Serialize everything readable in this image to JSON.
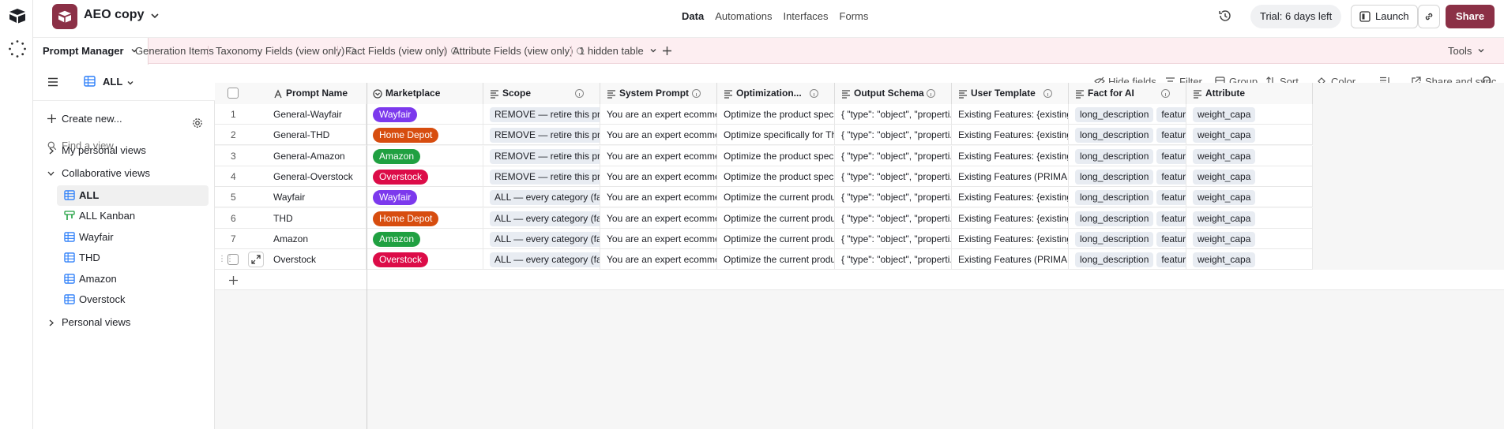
{
  "base": {
    "name": "AEO copy",
    "brand_color": "#8b3046"
  },
  "nav": [
    "Data",
    "Automations",
    "Interfaces",
    "Forms"
  ],
  "nav_active": "Data",
  "header": {
    "trial": "Trial: 6 days left",
    "launch": "Launch",
    "share": "Share"
  },
  "tables": [
    {
      "label": "Prompt Manager",
      "active": true,
      "has_chevron": true
    },
    {
      "label": "Generation Items",
      "info": false
    },
    {
      "label": "Taxonomy Fields (view only)",
      "info": true
    },
    {
      "label": "Fact Fields (view only)",
      "info": true
    },
    {
      "label": "Attribute Fields (view only)",
      "info": true
    },
    {
      "label": "1 hidden table",
      "has_chevron": true
    }
  ],
  "tools_label": "Tools",
  "view": {
    "name": "ALL"
  },
  "toolbar": {
    "hide_fields": "Hide fields",
    "filter": "Filter",
    "group": "Group",
    "sort": "Sort",
    "color": "Color",
    "share_sync": "Share and sync"
  },
  "sidebar": {
    "create": "Create new...",
    "find_placeholder": "Find a view",
    "personal_section": "My personal views",
    "collab_section": "Collaborative views",
    "views": [
      {
        "label": "ALL",
        "icon": "grid-icon",
        "active": true
      },
      {
        "label": "ALL Kanban",
        "icon": "kanban-icon"
      },
      {
        "label": "Wayfair",
        "icon": "grid-icon"
      },
      {
        "label": "THD",
        "icon": "grid-icon"
      },
      {
        "label": "Amazon",
        "icon": "grid-icon"
      },
      {
        "label": "Overstock",
        "icon": "grid-icon"
      }
    ],
    "personal_views": "Personal views"
  },
  "columns": [
    {
      "label": "Prompt Name",
      "icon": "text-icon"
    },
    {
      "label": "Marketplace",
      "icon": "select-icon"
    },
    {
      "label": "Scope",
      "icon": "longtext-icon"
    },
    {
      "label": "System Prompt",
      "icon": "longtext-icon"
    },
    {
      "label": "Optimization...",
      "icon": "longtext-icon"
    },
    {
      "label": "Output Schema",
      "icon": "longtext-icon"
    },
    {
      "label": "User Template",
      "icon": "longtext-icon"
    },
    {
      "label": "Fact for AI",
      "icon": "longtext-icon"
    },
    {
      "label": "Attribute",
      "icon": "longtext-icon"
    }
  ],
  "marketplace_colors": {
    "Wayfair": "#7c39ed",
    "Home Depot": "#d74d0f",
    "Amazon": "#20a041",
    "Overstock": "#dc0c48"
  },
  "rows": [
    {
      "n": "1",
      "name": "General-Wayfair",
      "market": "Wayfair",
      "scope": "REMOVE — retire this prompt",
      "system": "You are an expert ecommer...",
      "opt": "Optimize the product speci...",
      "schema": "{ \"type\": \"object\", \"properti...",
      "tmpl": "Existing Features: {existing_...",
      "fact1": "long_description",
      "fact2": "features",
      "attr": "weight_capa"
    },
    {
      "n": "2",
      "name": "General-THD",
      "market": "Home Depot",
      "scope": "REMOVE — retire this prompt",
      "system": "You are an expert ecommer...",
      "opt": "Optimize specifically for Th...",
      "schema": "{ \"type\": \"object\", \"properti...",
      "tmpl": "Existing Features: {existing_...",
      "fact1": "long_description",
      "fact2": "features",
      "attr": "weight_capa"
    },
    {
      "n": "3",
      "name": "General-Amazon",
      "market": "Amazon",
      "scope": "REMOVE — retire this prompt",
      "system": "You are an expert ecommer...",
      "opt": "Optimize the product speci...",
      "schema": "{ \"type\": \"object\", \"properti...",
      "tmpl": "Existing Features: {existing_...",
      "fact1": "long_description",
      "fact2": "features",
      "attr": "weight_capa"
    },
    {
      "n": "4",
      "name": "General-Overstock",
      "market": "Overstock",
      "scope": "REMOVE — retire this prompt",
      "system": "You are an expert ecommer...",
      "opt": "Optimize the product speci...",
      "schema": "{ \"type\": \"object\", \"properti...",
      "tmpl": "Existing Features (PRIMARY...",
      "fact1": "long_description",
      "fact2": "features",
      "attr": "weight_capa"
    },
    {
      "n": "5",
      "name": "Wayfair",
      "market": "Wayfair",
      "scope": "ALL — every category (fallback",
      "system": "You are an expert ecommer...",
      "opt": "Optimize the current produ...",
      "schema": "{ \"type\": \"object\", \"properti...",
      "tmpl": "Existing Features: {existing_...",
      "fact1": "long_description",
      "fact2": "features",
      "attr": "weight_capa"
    },
    {
      "n": "6",
      "name": "THD",
      "market": "Home Depot",
      "scope": "ALL — every category (fallback",
      "system": "You are an expert ecommer...",
      "opt": "Optimize the current produ...",
      "schema": "{ \"type\": \"object\", \"properti...",
      "tmpl": "Existing Features: {existing_...",
      "fact1": "long_description",
      "fact2": "features",
      "attr": "weight_capa"
    },
    {
      "n": "7",
      "name": "Amazon",
      "market": "Amazon",
      "scope": "ALL — every category (fallback",
      "system": "You are an expert ecommer...",
      "opt": "Optimize the current produ...",
      "schema": "{ \"type\": \"object\", \"properti...",
      "tmpl": "Existing Features: {existing_...",
      "fact1": "long_description",
      "fact2": "features",
      "attr": "weight_capa"
    },
    {
      "n": "",
      "name": "Overstock",
      "market": "Overstock",
      "scope": "ALL — every category (fallback",
      "system": "You are an expert ecommer...",
      "opt": "Optimize the current produ...",
      "schema": "{ \"type\": \"object\", \"properti...",
      "tmpl": "Existing Features (PRIMARY...",
      "fact1": "long_description",
      "fact2": "features",
      "attr": "weight_capa"
    }
  ]
}
